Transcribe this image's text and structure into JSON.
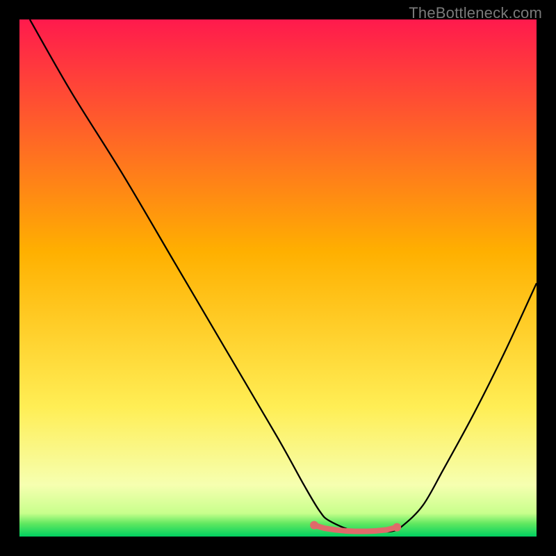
{
  "watermark": "TheBottleneck.com",
  "chart_data": {
    "type": "line",
    "title": "",
    "xlabel": "",
    "ylabel": "",
    "xlim": [
      0,
      100
    ],
    "ylim": [
      0,
      100
    ],
    "background_gradient": {
      "stops": [
        {
          "pos": 0.0,
          "color": "#ff1a4d"
        },
        {
          "pos": 0.45,
          "color": "#ffb000"
        },
        {
          "pos": 0.75,
          "color": "#ffee55"
        },
        {
          "pos": 0.9,
          "color": "#f6ffb0"
        },
        {
          "pos": 0.955,
          "color": "#c8ff8c"
        },
        {
          "pos": 0.975,
          "color": "#60e860"
        },
        {
          "pos": 1.0,
          "color": "#00d060"
        }
      ]
    },
    "series": [
      {
        "name": "bottleneck-curve",
        "color": "#000000",
        "x": [
          2,
          10,
          20,
          30,
          40,
          50,
          55,
          58,
          60,
          65,
          70,
          72,
          74,
          78,
          82,
          88,
          94,
          100
        ],
        "y": [
          100,
          86,
          70,
          53,
          36,
          19,
          10,
          5,
          3,
          1,
          1,
          1,
          2,
          6,
          13,
          24,
          36,
          49
        ]
      }
    ],
    "markers": {
      "name": "optimal-range",
      "color": "#e06a6a",
      "x": [
        57,
        59,
        61,
        63,
        65,
        67,
        69,
        71,
        73
      ],
      "y": [
        2.2,
        1.6,
        1.3,
        1.1,
        1.0,
        1.0,
        1.1,
        1.3,
        1.8
      ]
    }
  }
}
